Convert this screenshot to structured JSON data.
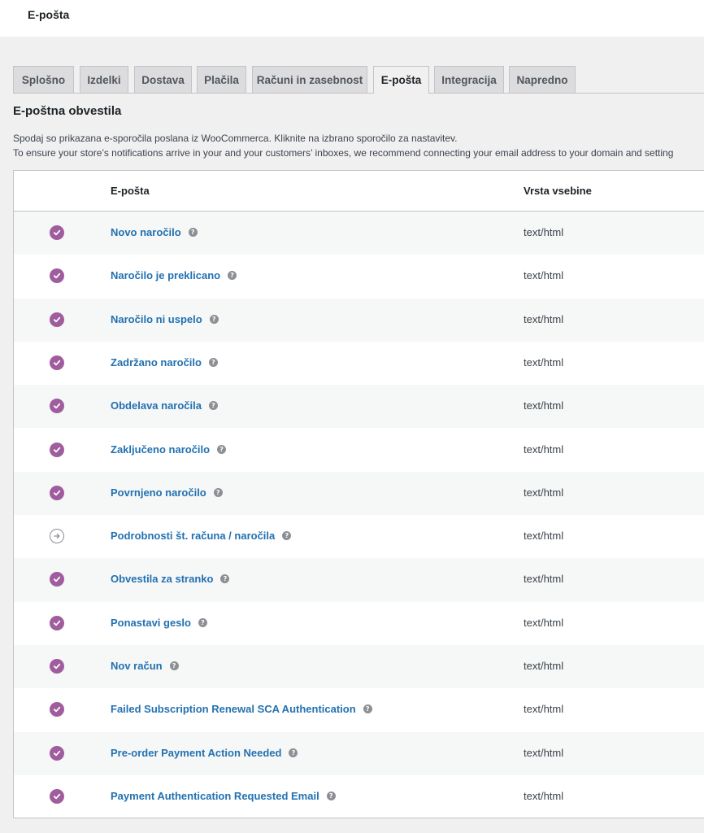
{
  "header": {
    "title": "E-pošta"
  },
  "tabs": [
    {
      "label": "Splošno",
      "active": false
    },
    {
      "label": "Izdelki",
      "active": false
    },
    {
      "label": "Dostava",
      "active": false
    },
    {
      "label": "Plačila",
      "active": false
    },
    {
      "label": "Računi in zasebnost",
      "active": false
    },
    {
      "label": "E-pošta",
      "active": true
    },
    {
      "label": "Integracija",
      "active": false
    },
    {
      "label": "Napredno",
      "active": false
    }
  ],
  "section": {
    "title": "E-poštna obvestila",
    "description_1": "Spodaj so prikazana e-sporočila poslana iz WooCommerca. Kliknite na izbrano sporočilo za nastavitev.",
    "description_2": "To ensure your store’s notifications arrive in your and your customers’ inboxes, we recommend connecting your email address to your domain and setting"
  },
  "table": {
    "headers": {
      "email": "E-pošta",
      "content_type": "Vrsta vsebine"
    },
    "rows": [
      {
        "name": "Novo naročilo",
        "content_type": "text/html",
        "enabled": true,
        "status_icon": "check-circle-icon"
      },
      {
        "name": "Naročilo je preklicano",
        "content_type": "text/html",
        "enabled": true,
        "status_icon": "check-circle-icon"
      },
      {
        "name": "Naročilo ni uspelo",
        "content_type": "text/html",
        "enabled": true,
        "status_icon": "check-circle-icon"
      },
      {
        "name": "Zadržano naročilo",
        "content_type": "text/html",
        "enabled": true,
        "status_icon": "check-circle-icon"
      },
      {
        "name": "Obdelava naročila",
        "content_type": "text/html",
        "enabled": true,
        "status_icon": "check-circle-icon"
      },
      {
        "name": "Zaključeno naročilo",
        "content_type": "text/html",
        "enabled": true,
        "status_icon": "check-circle-icon"
      },
      {
        "name": "Povrnjeno naročilo",
        "content_type": "text/html",
        "enabled": true,
        "status_icon": "check-circle-icon"
      },
      {
        "name": "Podrobnosti št. računa / naročila",
        "content_type": "text/html",
        "enabled": false,
        "status_icon": "manual-arrow-icon"
      },
      {
        "name": "Obvestila za stranko",
        "content_type": "text/html",
        "enabled": true,
        "status_icon": "check-circle-icon"
      },
      {
        "name": "Ponastavi geslo",
        "content_type": "text/html",
        "enabled": true,
        "status_icon": "check-circle-icon"
      },
      {
        "name": "Nov račun",
        "content_type": "text/html",
        "enabled": true,
        "status_icon": "check-circle-icon"
      },
      {
        "name": "Failed Subscription Renewal SCA Authentication",
        "content_type": "text/html",
        "enabled": true,
        "status_icon": "check-circle-icon"
      },
      {
        "name": "Pre-order Payment Action Needed",
        "content_type": "text/html",
        "enabled": true,
        "status_icon": "check-circle-icon"
      },
      {
        "name": "Payment Authentication Requested Email",
        "content_type": "text/html",
        "enabled": true,
        "status_icon": "check-circle-icon"
      }
    ]
  },
  "colors": {
    "enabled_status": "#a05d9e",
    "link": "#2271b1",
    "background": "#f0f0f1"
  }
}
